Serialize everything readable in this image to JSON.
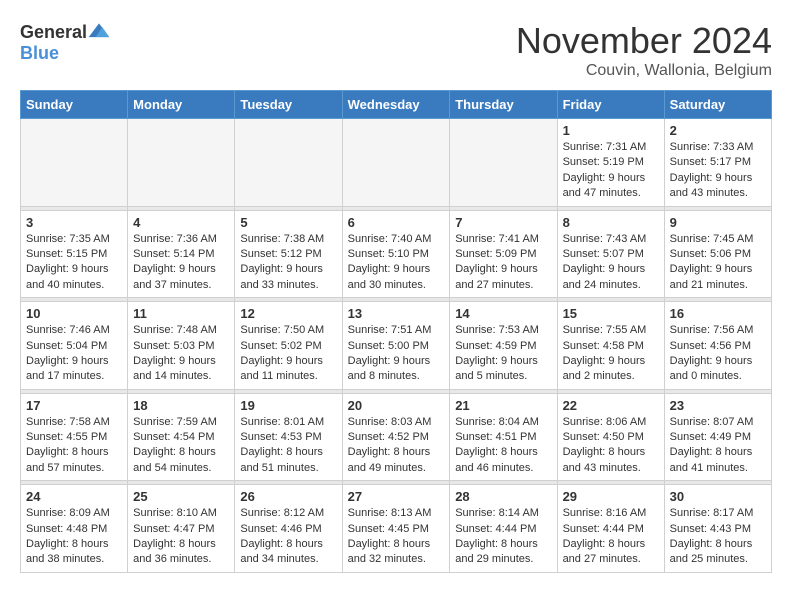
{
  "logo": {
    "general": "General",
    "blue": "Blue"
  },
  "title": "November 2024",
  "location": "Couvin, Wallonia, Belgium",
  "days_of_week": [
    "Sunday",
    "Monday",
    "Tuesday",
    "Wednesday",
    "Thursday",
    "Friday",
    "Saturday"
  ],
  "weeks": [
    [
      {
        "day": "",
        "info": ""
      },
      {
        "day": "",
        "info": ""
      },
      {
        "day": "",
        "info": ""
      },
      {
        "day": "",
        "info": ""
      },
      {
        "day": "",
        "info": ""
      },
      {
        "day": "1",
        "info": "Sunrise: 7:31 AM\nSunset: 5:19 PM\nDaylight: 9 hours and 47 minutes."
      },
      {
        "day": "2",
        "info": "Sunrise: 7:33 AM\nSunset: 5:17 PM\nDaylight: 9 hours and 43 minutes."
      }
    ],
    [
      {
        "day": "3",
        "info": "Sunrise: 7:35 AM\nSunset: 5:15 PM\nDaylight: 9 hours and 40 minutes."
      },
      {
        "day": "4",
        "info": "Sunrise: 7:36 AM\nSunset: 5:14 PM\nDaylight: 9 hours and 37 minutes."
      },
      {
        "day": "5",
        "info": "Sunrise: 7:38 AM\nSunset: 5:12 PM\nDaylight: 9 hours and 33 minutes."
      },
      {
        "day": "6",
        "info": "Sunrise: 7:40 AM\nSunset: 5:10 PM\nDaylight: 9 hours and 30 minutes."
      },
      {
        "day": "7",
        "info": "Sunrise: 7:41 AM\nSunset: 5:09 PM\nDaylight: 9 hours and 27 minutes."
      },
      {
        "day": "8",
        "info": "Sunrise: 7:43 AM\nSunset: 5:07 PM\nDaylight: 9 hours and 24 minutes."
      },
      {
        "day": "9",
        "info": "Sunrise: 7:45 AM\nSunset: 5:06 PM\nDaylight: 9 hours and 21 minutes."
      }
    ],
    [
      {
        "day": "10",
        "info": "Sunrise: 7:46 AM\nSunset: 5:04 PM\nDaylight: 9 hours and 17 minutes."
      },
      {
        "day": "11",
        "info": "Sunrise: 7:48 AM\nSunset: 5:03 PM\nDaylight: 9 hours and 14 minutes."
      },
      {
        "day": "12",
        "info": "Sunrise: 7:50 AM\nSunset: 5:02 PM\nDaylight: 9 hours and 11 minutes."
      },
      {
        "day": "13",
        "info": "Sunrise: 7:51 AM\nSunset: 5:00 PM\nDaylight: 9 hours and 8 minutes."
      },
      {
        "day": "14",
        "info": "Sunrise: 7:53 AM\nSunset: 4:59 PM\nDaylight: 9 hours and 5 minutes."
      },
      {
        "day": "15",
        "info": "Sunrise: 7:55 AM\nSunset: 4:58 PM\nDaylight: 9 hours and 2 minutes."
      },
      {
        "day": "16",
        "info": "Sunrise: 7:56 AM\nSunset: 4:56 PM\nDaylight: 9 hours and 0 minutes."
      }
    ],
    [
      {
        "day": "17",
        "info": "Sunrise: 7:58 AM\nSunset: 4:55 PM\nDaylight: 8 hours and 57 minutes."
      },
      {
        "day": "18",
        "info": "Sunrise: 7:59 AM\nSunset: 4:54 PM\nDaylight: 8 hours and 54 minutes."
      },
      {
        "day": "19",
        "info": "Sunrise: 8:01 AM\nSunset: 4:53 PM\nDaylight: 8 hours and 51 minutes."
      },
      {
        "day": "20",
        "info": "Sunrise: 8:03 AM\nSunset: 4:52 PM\nDaylight: 8 hours and 49 minutes."
      },
      {
        "day": "21",
        "info": "Sunrise: 8:04 AM\nSunset: 4:51 PM\nDaylight: 8 hours and 46 minutes."
      },
      {
        "day": "22",
        "info": "Sunrise: 8:06 AM\nSunset: 4:50 PM\nDaylight: 8 hours and 43 minutes."
      },
      {
        "day": "23",
        "info": "Sunrise: 8:07 AM\nSunset: 4:49 PM\nDaylight: 8 hours and 41 minutes."
      }
    ],
    [
      {
        "day": "24",
        "info": "Sunrise: 8:09 AM\nSunset: 4:48 PM\nDaylight: 8 hours and 38 minutes."
      },
      {
        "day": "25",
        "info": "Sunrise: 8:10 AM\nSunset: 4:47 PM\nDaylight: 8 hours and 36 minutes."
      },
      {
        "day": "26",
        "info": "Sunrise: 8:12 AM\nSunset: 4:46 PM\nDaylight: 8 hours and 34 minutes."
      },
      {
        "day": "27",
        "info": "Sunrise: 8:13 AM\nSunset: 4:45 PM\nDaylight: 8 hours and 32 minutes."
      },
      {
        "day": "28",
        "info": "Sunrise: 8:14 AM\nSunset: 4:44 PM\nDaylight: 8 hours and 29 minutes."
      },
      {
        "day": "29",
        "info": "Sunrise: 8:16 AM\nSunset: 4:44 PM\nDaylight: 8 hours and 27 minutes."
      },
      {
        "day": "30",
        "info": "Sunrise: 8:17 AM\nSunset: 4:43 PM\nDaylight: 8 hours and 25 minutes."
      }
    ]
  ]
}
